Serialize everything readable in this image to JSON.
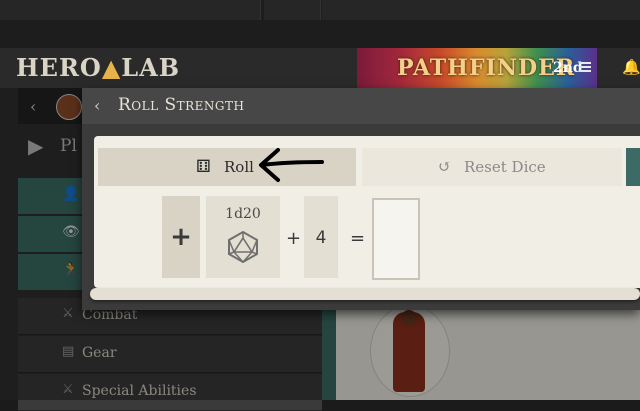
{
  "header": {
    "logo": {
      "left": "HERO",
      "right": "LAB"
    },
    "banner": {
      "title": "PATHFINDER",
      "edition": "2nd"
    }
  },
  "sidebar": {
    "title_partial": "Pl",
    "items": [
      {
        "label": "Combat",
        "icon": "crossed-swords-icon"
      },
      {
        "label": "Gear",
        "icon": "backpack-icon"
      },
      {
        "label": "Special Abilities",
        "icon": "crossed-swords-icon"
      }
    ],
    "teal_icons": [
      "person-icon",
      "eye-icon",
      "running-figure-icon"
    ]
  },
  "modal": {
    "title": "Roll Strength",
    "roll_label": "Roll",
    "reset_label": "Reset Dice",
    "add_label": "+",
    "die": "1d20",
    "plus": "+",
    "modifier": "4",
    "equals": "=",
    "result": ""
  },
  "colors": {
    "accent_teal": "#3b6b64",
    "paper": "#f1eee6",
    "button": "#d8d3c5"
  }
}
